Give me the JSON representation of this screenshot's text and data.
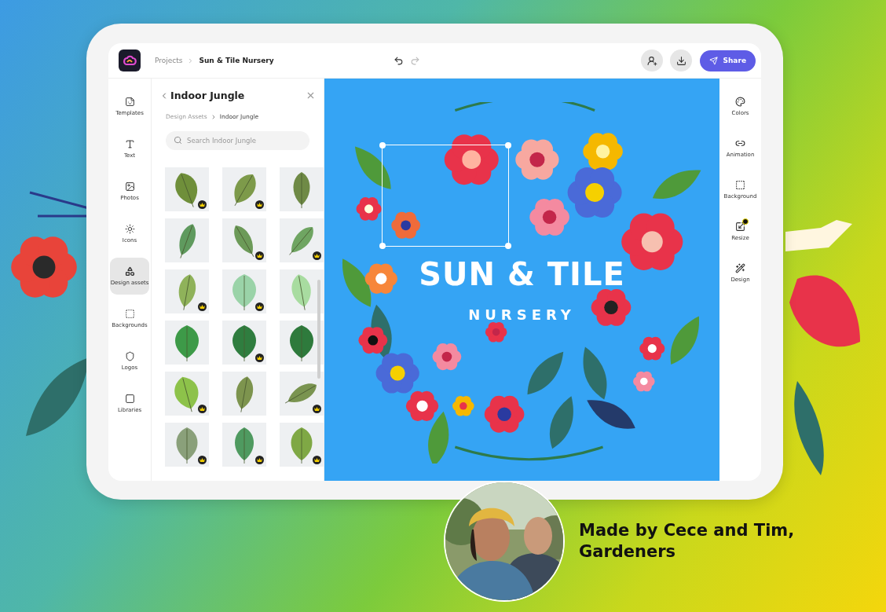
{
  "topbar": {
    "breadcrumb": [
      "Projects",
      "Sun & Tile Nursery"
    ],
    "share_label": "Share"
  },
  "left_rail": [
    {
      "label": "Templates",
      "selected": false
    },
    {
      "label": "Text",
      "selected": false
    },
    {
      "label": "Photos",
      "selected": false
    },
    {
      "label": "Icons",
      "selected": false
    },
    {
      "label": "Design assets",
      "selected": true
    },
    {
      "label": "Backgrounds",
      "selected": false
    },
    {
      "label": "Logos",
      "selected": false
    },
    {
      "label": "Libraries",
      "selected": false
    }
  ],
  "panel": {
    "title": "Indoor Jungle",
    "breadcrumb": [
      "Design Assets",
      "Indoor Jungle"
    ],
    "search": {
      "placeholder": "Search Indoor Jungle"
    },
    "assets": [
      {
        "premium": true
      },
      {
        "premium": true
      },
      {
        "premium": false
      },
      {
        "premium": false
      },
      {
        "premium": true
      },
      {
        "premium": true
      },
      {
        "premium": true
      },
      {
        "premium": true
      },
      {
        "premium": false
      },
      {
        "premium": false
      },
      {
        "premium": true
      },
      {
        "premium": false
      },
      {
        "premium": true
      },
      {
        "premium": false
      },
      {
        "premium": true
      },
      {
        "premium": true
      },
      {
        "premium": true
      },
      {
        "premium": true
      }
    ]
  },
  "canvas": {
    "headline": "SUN & TILE",
    "subheadline": "NURSERY",
    "element_selected": true
  },
  "right_rail": [
    {
      "label": "Colors",
      "badge": false
    },
    {
      "label": "Animation",
      "badge": false
    },
    {
      "label": "Background",
      "badge": false
    },
    {
      "label": "Resize",
      "badge": true
    },
    {
      "label": "Design",
      "badge": false
    }
  ],
  "caption": "Made by Cece and Tim, Gardeners"
}
